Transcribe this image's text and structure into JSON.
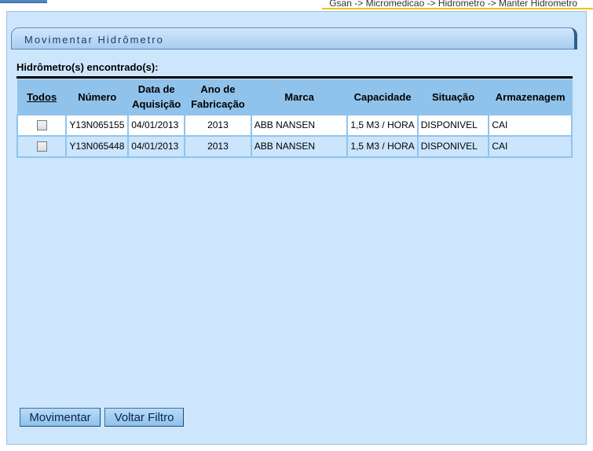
{
  "breadcrumb": "Gsan -> Micromedicao -> Hidrometro -> Manter Hidrometro",
  "panel_title": "Movimentar Hidrômetro",
  "found_label": "Hidrômetro(s) encontrado(s):",
  "table": {
    "headers": {
      "todos": "Todos",
      "numero": "Número",
      "data_aquisicao": "Data de Aquisição",
      "ano_fabricacao": "Ano de Fabricação",
      "marca": "Marca",
      "capacidade": "Capacidade",
      "situacao": "Situação",
      "armazenagem": "Armazenagem"
    },
    "rows": [
      {
        "numero": "Y13N065155",
        "data_aquisicao": "04/01/2013",
        "ano_fabricacao": "2013",
        "marca": "ABB NANSEN",
        "capacidade": "1,5 M3 / HORA",
        "situacao": "DISPONIVEL",
        "armazenagem": "CAI",
        "checked": false
      },
      {
        "numero": "Y13N065448",
        "data_aquisicao": "04/01/2013",
        "ano_fabricacao": "2013",
        "marca": "ABB NANSEN",
        "capacidade": "1,5 M3 / HORA",
        "situacao": "DISPONIVEL",
        "armazenagem": "CAI",
        "checked": false
      }
    ]
  },
  "buttons": {
    "movimentar": "Movimentar",
    "voltar_filtro": "Voltar Filtro"
  },
  "colors": {
    "panel_bg": "#cbe5fd",
    "header_bg": "#90c3ec",
    "accent_yellow": "#f2c200"
  }
}
